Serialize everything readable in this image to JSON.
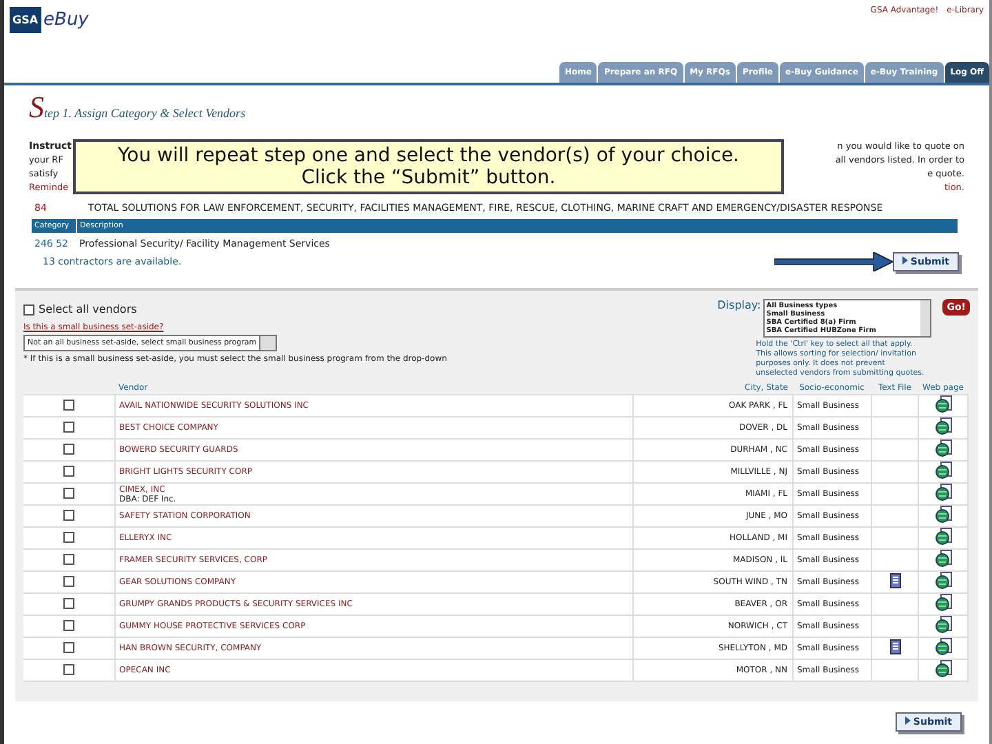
{
  "header": {
    "logo_mark": "GSA",
    "logo_text": "eBuy",
    "top_links": [
      "GSA Advantage!",
      "e-Library"
    ],
    "tabs": [
      {
        "label": "Home",
        "selected": false
      },
      {
        "label": "Prepare an RFQ",
        "selected": false
      },
      {
        "label": "My RFQs",
        "selected": false
      },
      {
        "label": "Profile",
        "selected": false
      },
      {
        "label": "e-Buy Guidance",
        "selected": false
      },
      {
        "label": "e-Buy Training",
        "selected": false
      },
      {
        "label": "Log Off",
        "selected": true
      }
    ]
  },
  "step_title": {
    "initial": "S",
    "rest": "tep 1. Assign Category & Select Vendors"
  },
  "instructions": [
    {
      "left": "Instruct",
      "right": "n you would like to quote on",
      "kind": "bold"
    },
    {
      "left": "your RF",
      "right": "all vendors listed. In order to",
      "kind": "plain"
    },
    {
      "left": "satisfy",
      "right": "e quote.",
      "kind": "plain"
    },
    {
      "left": "Reminde",
      "right": "tion.",
      "kind": "reminder"
    }
  ],
  "callout": {
    "line1": "You will repeat step one and select the vendor(s) of your choice.",
    "line2": "Click the “Submit” button."
  },
  "schedule": {
    "number": "84",
    "title": "TOTAL SOLUTIONS FOR LAW ENFORCEMENT, SECURITY, FACILITIES MANAGEMENT, FIRE, RESCUE, CLOTHING, MARINE CRAFT AND EMERGENCY/DISASTER RESPONSE"
  },
  "category_table": {
    "columns": [
      "Category",
      "Description"
    ],
    "rows": [
      {
        "category": "246 52",
        "description": "Professional Security/ Facility Management Services"
      }
    ]
  },
  "contractors_note": "13 contractors are available.",
  "submit_label": "Submit",
  "select_all": {
    "label": "Select all vendors",
    "checked": false
  },
  "set_aside": {
    "label": "Is this a small business set-aside?",
    "value": "Not an all business set-aside, select small business program",
    "note": "* If this is a small business set-aside, you must select the small business program from the drop-down"
  },
  "display": {
    "label": "Display:",
    "options": [
      "All Business types",
      "Small Business",
      "SBA Certified 8(a) Firm",
      "SBA Certified HUBZone Firm"
    ],
    "hint": "Hold the 'Ctrl' key to select all that apply. This allows sorting for selection/ invitation purposes only. It does not prevent unselected vendors from submitting quotes.",
    "go": "Go!"
  },
  "vendor_table": {
    "columns": [
      "Vendor",
      "City, State",
      "Socio-economic",
      "Text File",
      "Web page"
    ],
    "rows": [
      {
        "vendor": "AVAIL NATIONWIDE SECURITY SOLUTIONS INC",
        "city": "OAK PARK , FL",
        "socio": "Small Business",
        "checked": false,
        "text_file": false
      },
      {
        "vendor": "BEST CHOICE COMPANY",
        "city": "DOVER , DL",
        "socio": "Small Business",
        "checked": false,
        "text_file": false
      },
      {
        "vendor": "BOWERD SECURITY GUARDS",
        "city": "DURHAM , NC",
        "socio": "Small Business",
        "checked": false,
        "text_file": false
      },
      {
        "vendor": "BRIGHT LIGHTS SECURITY CORP",
        "city": "MILLVILLE , NJ",
        "socio": "Small Business",
        "checked": false,
        "text_file": false
      },
      {
        "vendor": "CIMEX, INC",
        "dba": "DBA: DEF Inc.",
        "city": "MIAMI , FL",
        "socio": "Small Business",
        "checked": false,
        "text_file": false
      },
      {
        "vendor": "SAFETY STATION CORPORATION",
        "city": "JUNE , MO",
        "socio": "Small Business",
        "checked": false,
        "text_file": false
      },
      {
        "vendor": "ELLERYX INC",
        "city": "HOLLAND , MI",
        "socio": "Small Business",
        "checked": false,
        "text_file": false
      },
      {
        "vendor": "FRAMER SECURITY SERVICES, CORP",
        "city": "MADISON , IL",
        "socio": "Small Business",
        "checked": false,
        "text_file": false
      },
      {
        "vendor": "GEAR SOLUTIONS COMPANY",
        "city": "SOUTH WIND , TN",
        "socio": "Small Business",
        "checked": false,
        "text_file": true
      },
      {
        "vendor": "GRUMPY GRANDS PRODUCTS & SECURITY SERVICES INC",
        "city": "BEAVER , OR",
        "socio": "Small Business",
        "checked": false,
        "text_file": false
      },
      {
        "vendor": "GUMMY HOUSE PROTECTIVE SERVICES CORP",
        "city": "NORWICH , CT",
        "socio": "Small Business",
        "checked": false,
        "text_file": false
      },
      {
        "vendor": "HAN BROWN SECURITY, COMPANY",
        "city": "SHELLYTON , MD",
        "socio": "Small Business",
        "checked": false,
        "text_file": true
      },
      {
        "vendor": "OPECAN INC",
        "city": "MOTOR , NN",
        "socio": "Small Business",
        "checked": false,
        "text_file": false
      }
    ]
  },
  "bottom_submit_label": "Submit"
}
